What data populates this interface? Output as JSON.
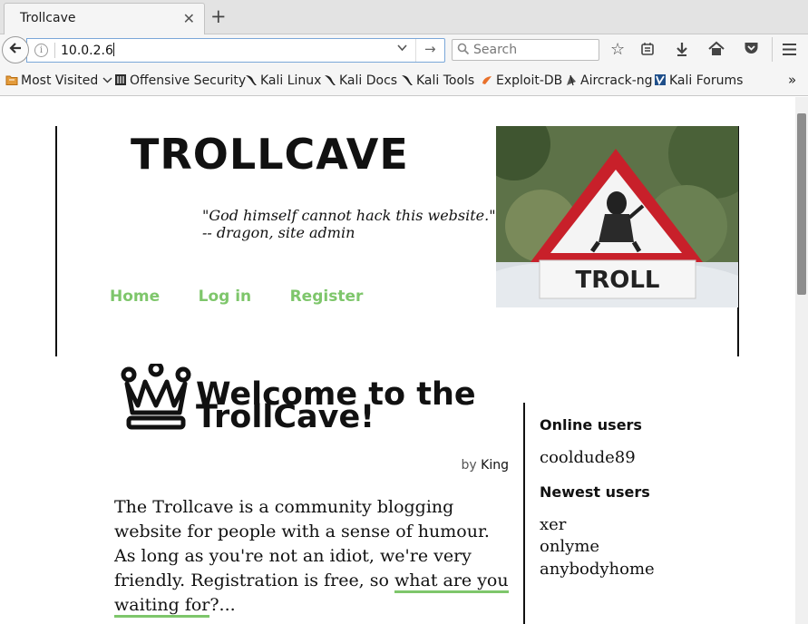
{
  "browser": {
    "tab_title": "Trollcave",
    "url": "10.0.2.6",
    "search_placeholder": "Search"
  },
  "bookmarks": [
    {
      "label": "Most Visited",
      "icon": "folder-icon"
    },
    {
      "label": "Offensive Security",
      "icon": "offsec-icon"
    },
    {
      "label": "Kali Linux",
      "icon": "kali-dragon-icon"
    },
    {
      "label": "Kali Docs",
      "icon": "kali-dragon-icon"
    },
    {
      "label": "Kali Tools",
      "icon": "kali-dragon-icon"
    },
    {
      "label": "Exploit-DB",
      "icon": "exploitdb-icon"
    },
    {
      "label": "Aircrack-ng",
      "icon": "aircrack-icon"
    },
    {
      "label": "Kali Forums",
      "icon": "kali-forums-icon"
    }
  ],
  "site": {
    "title": "TROLLCAVE",
    "quote_line1": "\"God himself cannot hack this website.\"",
    "quote_line2": "-- dragon, site admin",
    "nav": [
      "Home",
      "Log in",
      "Register"
    ],
    "sign_text": "TROLL"
  },
  "post": {
    "title": "Welcome to the TrollCave!",
    "by_prefix": "by",
    "author": "King",
    "intro_before_link": "The Trollcave is a community blogging website for people with a sense of humour. As long as you're not an idiot, we're very friendly. Registration is free, so ",
    "intro_link": "what are you waiting for",
    "intro_after_link": "?..."
  },
  "sidebar": {
    "online_heading": "Online users",
    "online_users": [
      "cooldude89"
    ],
    "newest_heading": "Newest users",
    "newest_users": [
      "xer",
      "onlyme",
      "anybodyhome"
    ]
  },
  "colors": {
    "accent_green": "#7ec66b"
  }
}
